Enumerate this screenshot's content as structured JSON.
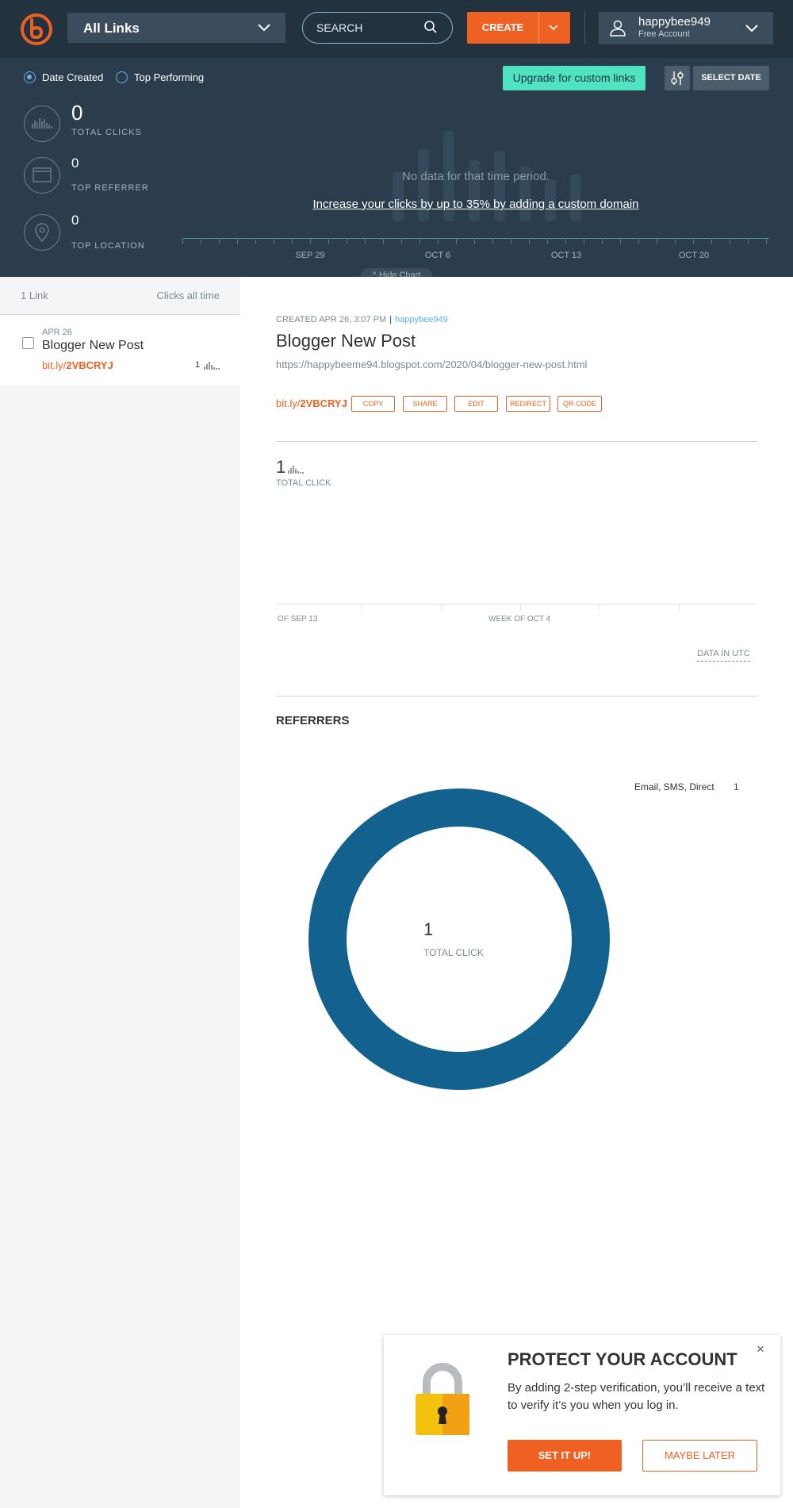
{
  "topbar": {
    "links_select": "All Links",
    "search_placeholder": "SEARCH",
    "create_label": "CREATE",
    "account_name": "happybee949",
    "account_plan": "Free Account"
  },
  "filters": {
    "date_created": "Date Created",
    "top_performing": "Top Performing",
    "selected": "Date Created",
    "upgrade_label": "Upgrade for custom links",
    "select_date": "SELECT DATE"
  },
  "stats": [
    {
      "value": "0",
      "label": "TOTAL CLICKS",
      "icon": "bar-chart-icon"
    },
    {
      "value": "0",
      "label": "TOP REFERRER",
      "icon": "browser-window-icon"
    },
    {
      "value": "0",
      "label": "TOP LOCATION",
      "icon": "location-pin-icon"
    }
  ],
  "overview_chart": {
    "no_data": "No data for that time period.",
    "promo_link": "Increase your clicks by up to 35% by adding a custom domain",
    "ticks": [
      "SEP 29",
      "OCT 6",
      "OCT 13",
      "OCT 20"
    ],
    "hide_chart": "Hide Chart"
  },
  "list": {
    "count_label": "1 Link",
    "sort_label": "Clicks all time",
    "items": [
      {
        "date": "APR 26",
        "title": "Blogger New Post",
        "short_domain": "bit.ly/",
        "short_code": "2VBCRYJ",
        "clicks": "1"
      }
    ]
  },
  "detail": {
    "created": "CREATED APR 26, 3:07 PM",
    "user": "happybee949",
    "title": "Blogger New Post",
    "long_url": "https://happybeeme94.blogspot.com/2020/04/blogger-new-post.html",
    "short_domain": "bit.ly/",
    "short_code": "2VBCRYJ",
    "actions": [
      "COPY",
      "SHARE",
      "EDIT",
      "REDIRECT",
      "QR CODE"
    ],
    "total_clicks": "1",
    "total_click_label": "TOTAL CLICK",
    "chart_ticks": [
      "OF SEP 13",
      "WEEK OF OCT 4"
    ],
    "data_utc": "DATA IN UTC",
    "referrers_title": "REFERRERS",
    "referrers": [
      {
        "name": "Email, SMS, Direct",
        "value": "1"
      }
    ],
    "donut_total": "1",
    "donut_label": "TOTAL CLICK",
    "donut_color": "#12618f"
  },
  "protect": {
    "title": "PROTECT YOUR ACCOUNT",
    "text": "By adding 2-step verification, you’ll receive a text to verify it’s you when you log in.",
    "set_it_up": "SET IT UP!",
    "maybe_later": "MAYBE LATER",
    "close": "×"
  },
  "colors": {
    "brand_orange": "#ee6123",
    "header_bg": "#2b3d4d",
    "accent_teal": "#50e3c2",
    "link_blue": "#5ab1e0"
  }
}
